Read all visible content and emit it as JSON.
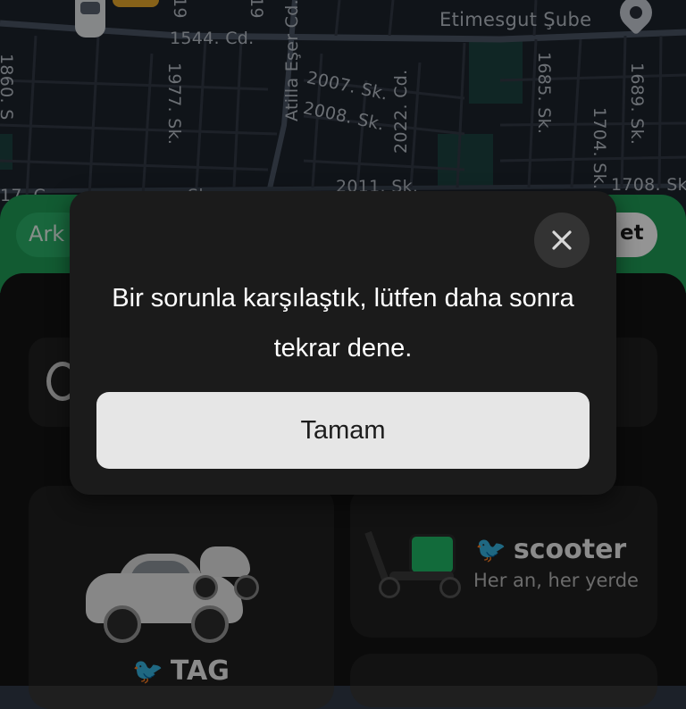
{
  "map": {
    "streets": [
      "1544. Cd.",
      "1977. Sk.",
      "Atilla Eşer Cd.",
      "2007. Sk.",
      "2008. Sk.",
      "2022. Cd.",
      "2011. Sk.",
      "1685. Sk.",
      "1704. Sk.",
      "1689. Sk.",
      "1708. Sk",
      "Etimesgut Şube",
      "19",
      "19",
      "1860. S",
      "17. C",
      "Sk"
    ]
  },
  "header": {
    "left_chip": "Ark",
    "right_chip": "et"
  },
  "tiles": {
    "tag": {
      "name": "TAG"
    },
    "scooter": {
      "name": "scooter",
      "subtitle": "Her an, her yerde"
    }
  },
  "dialog": {
    "message": "Bir sorunla karşılaştık, lütfen daha sonra tekrar dene.",
    "ok_label": "Tamam",
    "close_icon": "close-icon"
  },
  "colors": {
    "brand_green": "#1f9d57",
    "dialog_bg": "#1b1b1b",
    "button_bg": "#e6e6e6"
  }
}
